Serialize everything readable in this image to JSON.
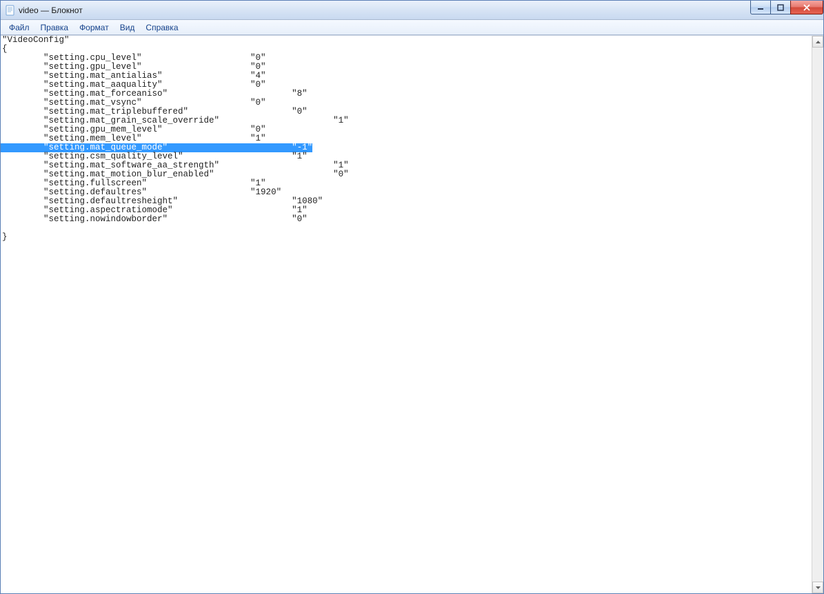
{
  "window": {
    "title": "video — Блокнот"
  },
  "menu": {
    "items": [
      "Файл",
      "Правка",
      "Формат",
      "Вид",
      "Справка"
    ]
  },
  "editor": {
    "header": "\"VideoConfig\"",
    "open_brace": "{",
    "close_brace": "}",
    "selected_index": 12,
    "lines": [
      {
        "key": "\"setting.cpu_level\"",
        "val": "\"0\"",
        "kcol": 8,
        "vcol": 48
      },
      {
        "key": "\"setting.gpu_level\"",
        "val": "\"0\"",
        "kcol": 8,
        "vcol": 48
      },
      {
        "key": "\"setting.mat_antialias\"",
        "val": "\"4\"",
        "kcol": 8,
        "vcol": 48
      },
      {
        "key": "\"setting.mat_aaquality\"",
        "val": "\"0\"",
        "kcol": 8,
        "vcol": 48
      },
      {
        "key": "\"setting.mat_forceaniso\"",
        "val": "\"8\"",
        "kcol": 8,
        "vcol": 56
      },
      {
        "key": "\"setting.mat_vsync\"",
        "val": "\"0\"",
        "kcol": 8,
        "vcol": 48
      },
      {
        "key": "\"setting.mat_triplebuffered\"",
        "val": "\"0\"",
        "kcol": 8,
        "vcol": 56
      },
      {
        "key": "\"setting.mat_grain_scale_override\"",
        "val": "\"1\"",
        "kcol": 8,
        "vcol": 64
      },
      {
        "key": "\"setting.gpu_mem_level\"",
        "val": "\"0\"",
        "kcol": 8,
        "vcol": 48
      },
      {
        "key": "\"setting.mem_level\"",
        "val": "\"1\"",
        "kcol": 8,
        "vcol": 48
      },
      {
        "key": "\"setting.mat_queue_mode\"",
        "val": "\"-1\"",
        "kcol": 8,
        "vcol": 56
      },
      {
        "key": "\"setting.csm_quality_level\"",
        "val": "\"1\"",
        "kcol": 8,
        "vcol": 56
      },
      {
        "key": "\"setting.mat_software_aa_strength\"",
        "val": "\"1\"",
        "kcol": 8,
        "vcol": 64
      },
      {
        "key": "\"setting.mat_motion_blur_enabled\"",
        "val": "\"0\"",
        "kcol": 8,
        "vcol": 64
      },
      {
        "key": "\"setting.fullscreen\"",
        "val": "\"1\"",
        "kcol": 8,
        "vcol": 48
      },
      {
        "key": "\"setting.defaultres\"",
        "val": "\"1920\"",
        "kcol": 8,
        "vcol": 48
      },
      {
        "key": "\"setting.defaultresheight\"",
        "val": "\"1080\"",
        "kcol": 8,
        "vcol": 56
      },
      {
        "key": "\"setting.aspectratiomode\"",
        "val": "\"1\"",
        "kcol": 8,
        "vcol": 56
      },
      {
        "key": "\"setting.nowindowborder\"",
        "val": "\"0\"",
        "kcol": 8,
        "vcol": 56
      }
    ]
  }
}
